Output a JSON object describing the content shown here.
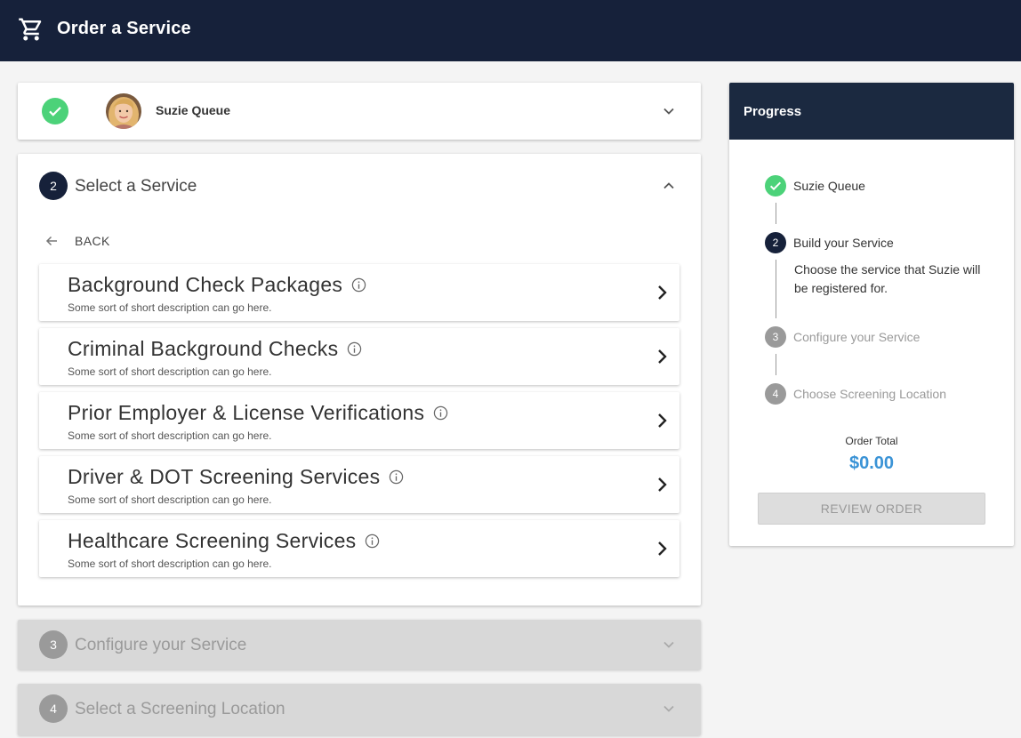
{
  "header": {
    "title": "Order a Service",
    "icon": "cart-icon"
  },
  "step1": {
    "name": "Suzie Queue",
    "status_icon": "check-icon",
    "expand_icon": "chevron-down-icon"
  },
  "step2": {
    "number": "2",
    "title": "Select a Service",
    "collapse_icon": "chevron-up-icon",
    "back_label": "BACK",
    "services": [
      {
        "title": "Background Check Packages",
        "description": "Some sort of short description can go here."
      },
      {
        "title": "Criminal Background Checks",
        "description": "Some sort of short description can go here."
      },
      {
        "title": "Prior Employer & License Verifications",
        "description": "Some sort of short description can go here."
      },
      {
        "title": "Driver & DOT Screening Services",
        "description": "Some sort of short description can go here."
      },
      {
        "title": "Healthcare Screening Services",
        "description": "Some sort of short description can go here."
      }
    ]
  },
  "step3": {
    "number": "3",
    "title": "Configure your Service"
  },
  "step4": {
    "number": "4",
    "title": "Select a Screening Location"
  },
  "progress": {
    "title": "Progress",
    "steps": [
      {
        "number": "",
        "label": "Suzie Queue",
        "state": "complete"
      },
      {
        "number": "2",
        "label": "Build your Service",
        "state": "active",
        "description": "Choose the service that Suzie will be registered for."
      },
      {
        "number": "3",
        "label": "Configure your Service",
        "state": "pending"
      },
      {
        "number": "4",
        "label": "Choose Screening Location",
        "state": "pending"
      }
    ],
    "order_total_label": "Order Total",
    "order_total_value": "$0.00",
    "review_button": "REVIEW ORDER"
  },
  "colors": {
    "header_bg": "#16213a",
    "success": "#4cd279",
    "accent": "#3a93d6",
    "disabled": "#9a9a9a"
  }
}
